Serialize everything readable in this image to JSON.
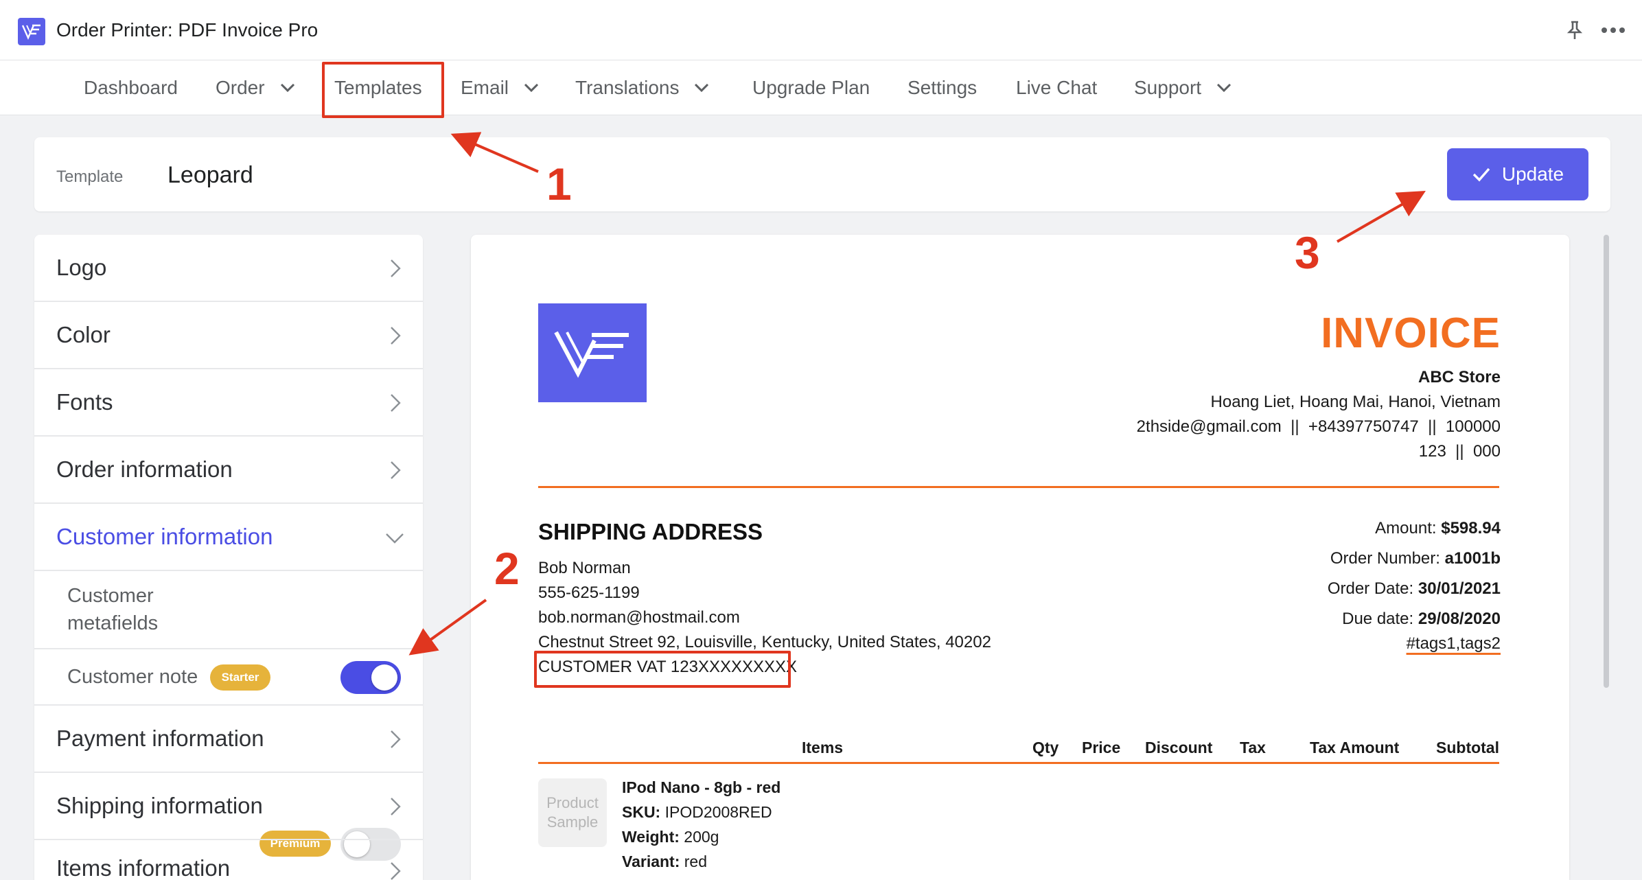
{
  "app": {
    "title": "Order Printer: PDF Invoice Pro"
  },
  "nav": {
    "items": [
      {
        "label": "Dashboard"
      },
      {
        "label": "Order"
      },
      {
        "label": "Templates"
      },
      {
        "label": "Email"
      },
      {
        "label": "Translations"
      },
      {
        "label": "Upgrade Plan"
      },
      {
        "label": "Settings"
      },
      {
        "label": "Live Chat"
      },
      {
        "label": "Support"
      }
    ]
  },
  "template": {
    "label": "Template",
    "name": "Leopard",
    "update_label": "Update"
  },
  "panel": {
    "rows": [
      {
        "label": "Logo"
      },
      {
        "label": "Color"
      },
      {
        "label": "Fonts"
      },
      {
        "label": "Order information"
      },
      {
        "label": "Customer information"
      },
      {
        "label": "Payment information"
      },
      {
        "label": "Shipping information"
      },
      {
        "label": "Items information"
      }
    ],
    "sub": [
      {
        "label_line1": "Customer",
        "label_line2": "metafields",
        "badge": "Premium",
        "enabled": false
      },
      {
        "label": "Customer note",
        "badge": "Starter",
        "enabled": true
      }
    ]
  },
  "invoice": {
    "title": "INVOICE",
    "store_name": "ABC Store",
    "store_address": "Hoang Liet, Hoang Mai, Hanoi, Vietnam",
    "store_contact": "2thside@gmail.com  ||  +84397750747  ||  100000",
    "store_extra": "123  ||  000",
    "shipping_heading": "SHIPPING ADDRESS",
    "shipping_lines": [
      "Bob Norman",
      "555-625-1199",
      "bob.norman@hostmail.com",
      "Chestnut Street 92, Louisville, Kentucky, United States, 40202",
      "CUSTOMER VAT 123XXXXXXXXX"
    ],
    "meta": [
      {
        "label": "Amount:",
        "value": "$598.94"
      },
      {
        "label": "Order Number:",
        "value": "a1001b"
      },
      {
        "label": "Order Date:",
        "value": "30/01/2021"
      },
      {
        "label": "Due date:",
        "value": "29/08/2020"
      }
    ],
    "tags": "#tags1,tags2",
    "columns": [
      "Items",
      "Qty",
      "Price",
      "Discount",
      "Tax",
      "Tax Amount",
      "Subtotal"
    ],
    "product": {
      "thumb_text": "Product Sample",
      "name": "IPod Nano - 8gb - red",
      "sku_label": "SKU:",
      "sku": "IPOD2008RED",
      "weight_label": "Weight:",
      "weight": "200g",
      "variant_label": "Variant:",
      "variant": "red"
    }
  },
  "annotations": {
    "step1": "1",
    "step2": "2",
    "step3": "3"
  },
  "colors": {
    "accent": "#5b5fe9",
    "invoice_orange": "#f26e21",
    "annotation_red": "#e0361f",
    "badge_yellow": "#e6b33b"
  }
}
